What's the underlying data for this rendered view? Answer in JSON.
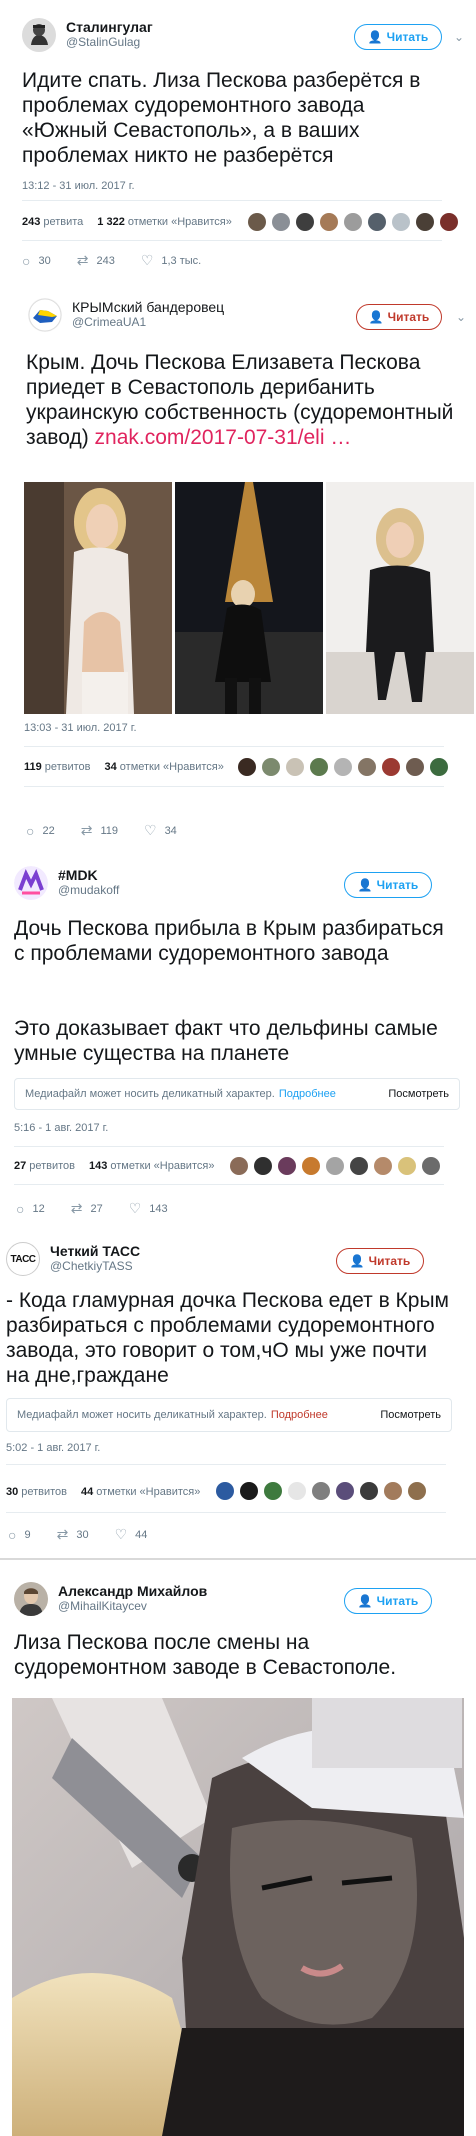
{
  "tweets": [
    {
      "name": "Сталингулаг",
      "handle": "@StalinGulag",
      "follow": "Читать",
      "text": "Идите спать. Лиза Пескова разберётся в проблемах судоремонтного завода «Южный Севастополь», а в ваших проблемах никто не разберётся",
      "time": "13:12 - 31 июл. 2017 г.",
      "retweets_count": "243",
      "retweets_label": "ретвита",
      "likes_count": "1 322",
      "likes_label": "отметки «Нравится»",
      "reply_count": "30",
      "retweet_count_action": "243",
      "like_count_action": "1,3 тыс."
    },
    {
      "name": "КРЫМский бандеровец",
      "handle": "@CrimeaUA1",
      "follow": "Читать",
      "text": "Крым. Дочь Пескова Елизавета Пескова приедет в Севастополь дерибанить украинскую собственность (судоремонтный завод) ",
      "link": "znak.com/2017-07-31/eli …",
      "time": "13:03 - 31 июл. 2017 г.",
      "retweets_count": "119",
      "retweets_label": "ретвитов",
      "likes_count": "34",
      "likes_label": "отметки «Нравится»",
      "reply_count": "22",
      "retweet_count_action": "119",
      "like_count_action": "34"
    },
    {
      "name": "#MDK",
      "handle": "@mudakoff",
      "follow": "Читать",
      "text1": "Дочь Пескова прибыла в Крым разбираться с проблемами судоремонтного завода",
      "text2": "Это доказывает факт что дельфины самые умные существа на планете",
      "sensitive": "Медиафайл может носить деликатный характер.",
      "sensitive_more": "Подробнее",
      "sensitive_show": "Посмотреть",
      "time": "5:16 - 1 авг. 2017 г.",
      "retweets_count": "27",
      "retweets_label": "ретвитов",
      "likes_count": "143",
      "likes_label": "отметки «Нравится»",
      "reply_count": "12",
      "retweet_count_action": "27",
      "like_count_action": "143"
    },
    {
      "name": "Четкий ТАСС",
      "handle": "@ChetkiyTASS",
      "follow": "Читать",
      "avatar_text": "TACC",
      "text": "- Кода гламурная дочка Пескова едет в Крым разбираться с проблемами судоремонтного завода, это говорит о том,чО мы уже почти на дне,граждане",
      "sensitive": "Медиафайл может носить деликатный характер.",
      "sensitive_more": "Подробнее",
      "sensitive_show": "Посмотреть",
      "time": "5:02 - 1 авг. 2017 г.",
      "retweets_count": "30",
      "retweets_label": "ретвитов",
      "likes_count": "44",
      "likes_label": "отметки «Нравится»",
      "reply_count": "9",
      "retweet_count_action": "30",
      "like_count_action": "44"
    },
    {
      "name": "Александр Михайлов",
      "handle": "@MihailKitaycev",
      "follow": "Читать",
      "text": "Лиза Пескова после смены на судоремонтном заводе в Севастополе."
    }
  ],
  "colors": {
    "blue": "#1da1f2",
    "red": "#c0392b",
    "gray": "#657786"
  }
}
